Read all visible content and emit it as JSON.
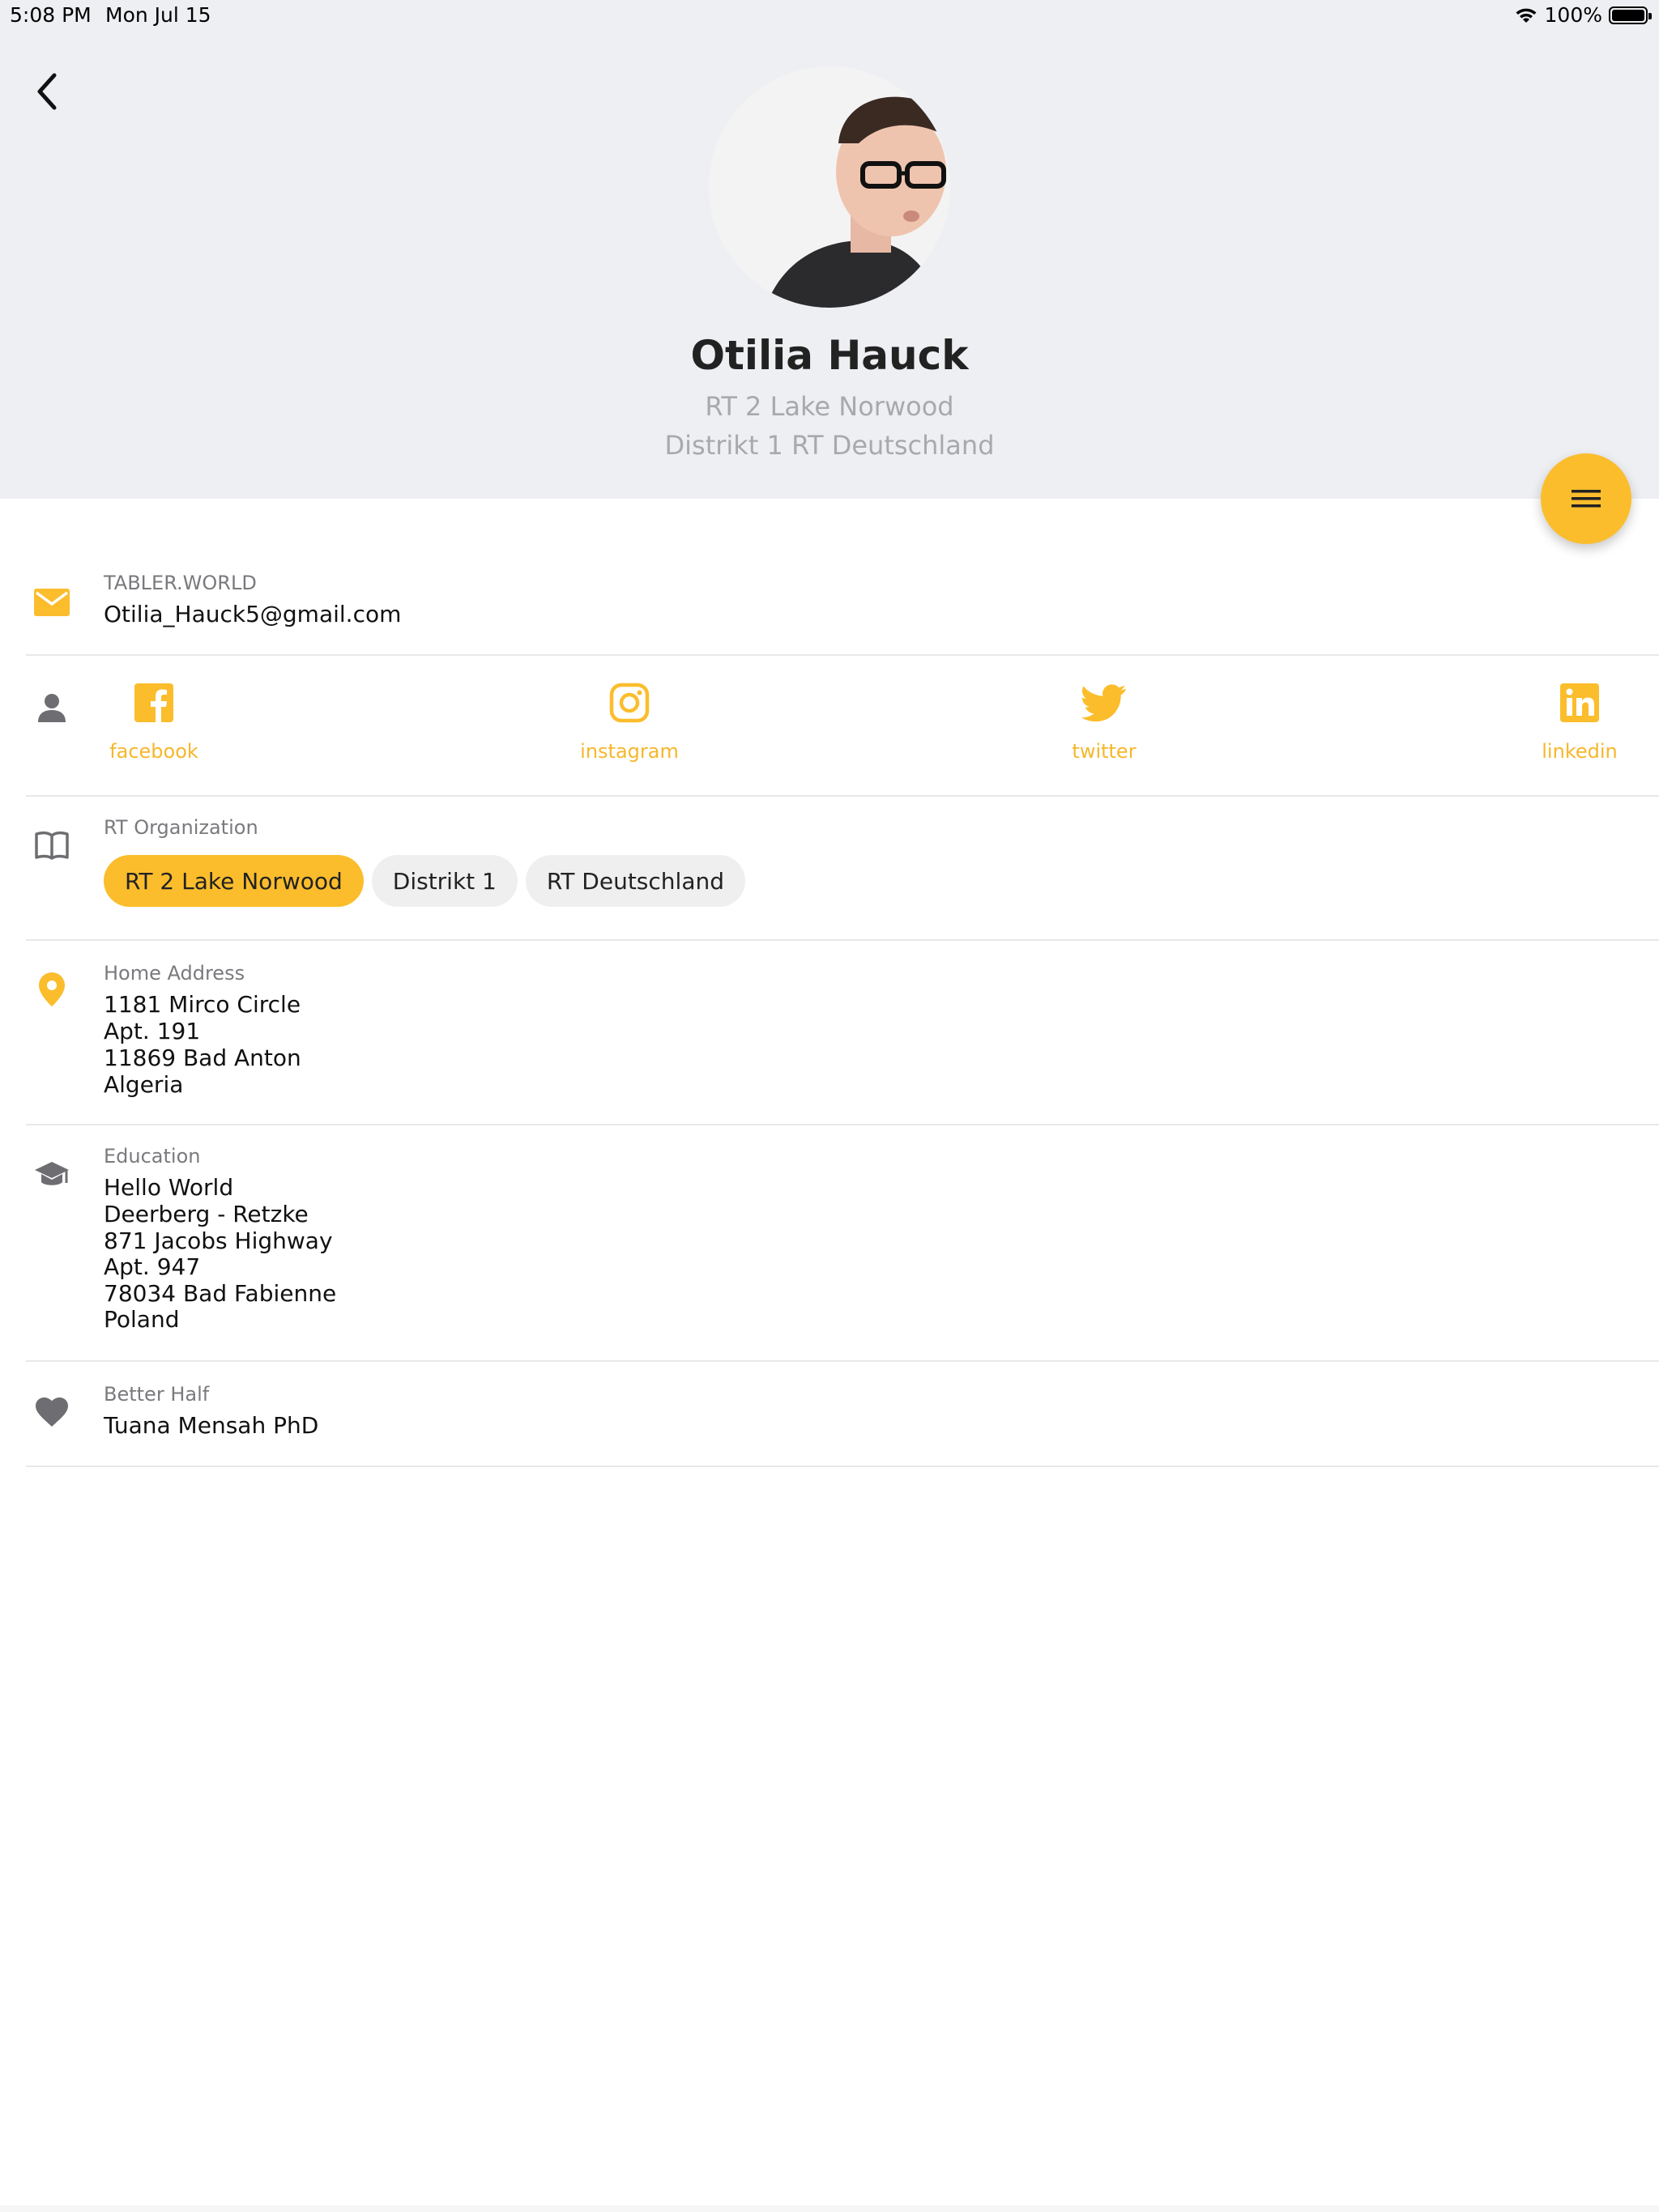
{
  "status_bar": {
    "time": "5:08 PM",
    "date": "Mon Jul 15",
    "battery": "100%"
  },
  "profile": {
    "name": "Otilia Hauck",
    "line1": "RT 2 Lake Norwood",
    "line2": "Distrikt 1 RT Deutschland"
  },
  "email_row": {
    "label": "TABLER.WORLD",
    "value": "Otilia_Hauck5@gmail.com"
  },
  "social": [
    {
      "label": "facebook",
      "icon": "facebook-icon"
    },
    {
      "label": "instagram",
      "icon": "instagram-icon"
    },
    {
      "label": "twitter",
      "icon": "twitter-icon"
    },
    {
      "label": "linkedin",
      "icon": "linkedin-icon"
    }
  ],
  "organization": {
    "label": "RT Organization",
    "chips": [
      "RT 2 Lake Norwood",
      "Distrikt 1",
      "RT Deutschland"
    ]
  },
  "home_address": {
    "label": "Home Address",
    "lines": [
      "1181 Mirco Circle",
      "Apt. 191",
      "11869 Bad Anton",
      "Algeria"
    ]
  },
  "education": {
    "label": "Education",
    "lines": [
      "Hello World",
      "Deerberg - Retzke",
      "871 Jacobs Highway",
      "Apt. 947",
      "78034 Bad Fabienne",
      "Poland"
    ]
  },
  "better_half": {
    "label": "Better Half",
    "value": "Tuana Mensah PhD"
  },
  "colors": {
    "accent": "#fbbd2c",
    "header_bg": "#eeeff2",
    "icon_gray": "#6e6e72"
  }
}
